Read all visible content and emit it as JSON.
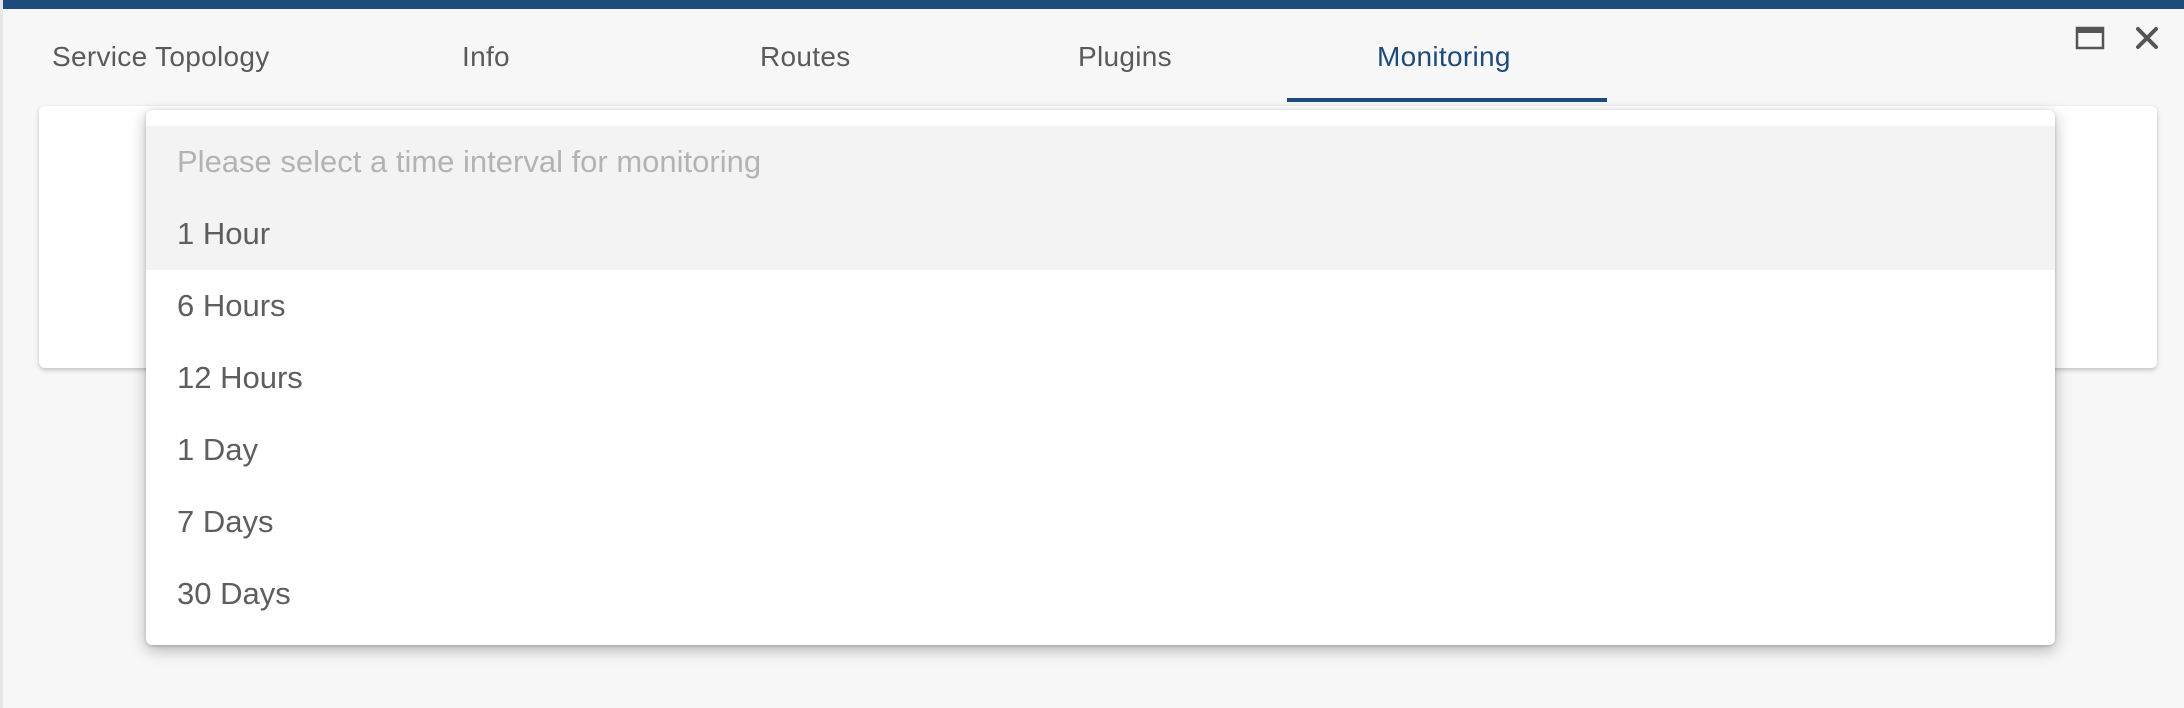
{
  "tabs": [
    {
      "label": "Service Topology"
    },
    {
      "label": "Info"
    },
    {
      "label": "Routes"
    },
    {
      "label": "Plugins"
    },
    {
      "label": "Monitoring",
      "active": true
    }
  ],
  "window_controls": {
    "maximize_icon": "maximize-icon",
    "close_icon": "close-icon"
  },
  "dropdown": {
    "placeholder": "Please select a time interval for monitoring",
    "highlighted_index": 0,
    "options": [
      "1 Hour",
      "6 Hours",
      "12 Hours",
      "1 Day",
      "7 Days",
      "30 Days"
    ]
  },
  "colors": {
    "accent": "#1e4a7c",
    "text": "#5e5e5e",
    "placeholder_text": "#b3b3b3",
    "highlight_bg": "#f3f3f3"
  }
}
